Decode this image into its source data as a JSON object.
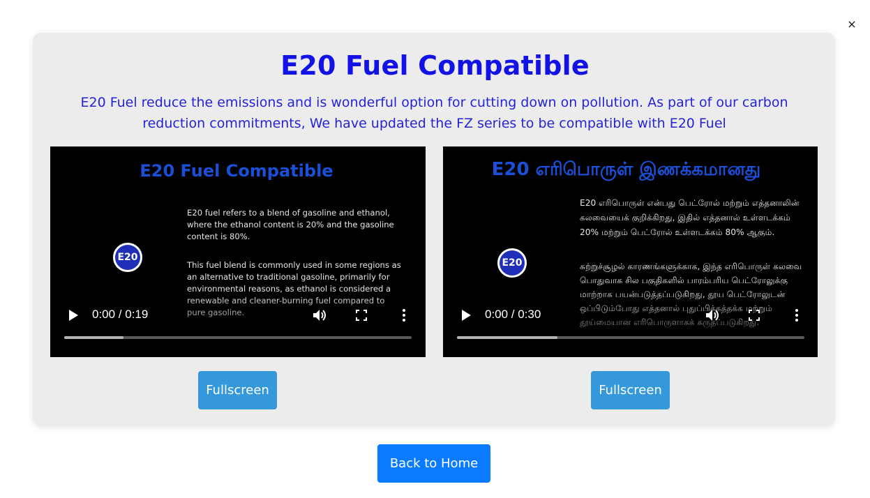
{
  "close_label": "×",
  "header": {
    "title": "E20 Fuel Compatible",
    "description": "E20 Fuel reduce the emissions and is wonderful option for cutting down on pollution. As part of our carbon reduction commitments, We have updated the FZ series to be compatible with E20 Fuel"
  },
  "videos": [
    {
      "title": "E20 Fuel Compatible",
      "badge": "E20",
      "paragraph1": "E20 fuel refers to a blend of gasoline and ethanol, where the ethanol content is 20% and the gasoline content is 80%.",
      "paragraph2": "This fuel blend is commonly used in some regions as an alternative to traditional gasoline, primarily for environmental reasons, as ethanol is considered a renewable and cleaner-burning fuel compared to pure gasoline.",
      "time": "0:00 / 0:19",
      "buffered_fraction": 0.17,
      "fullscreen_label": "Fullscreen"
    },
    {
      "title": "E20 எரிபொருள் இணக்கமானது",
      "badge": "E20",
      "paragraph1": "E20 எரிபொருள் என்பது பெட்ரோல் மற்றும் எத்தனாலின் கலவையைக் குறிக்கிறது, இதில் எத்தனால் உள்ளடக்கம் 20% மற்றும் பெட்ரோல் உள்ளடக்கம் 80% ஆகும்.",
      "paragraph2": "சுற்றுச்சூழல் காரணங்களுக்காக, இந்த எரிபொருள் கலவை பொதுவாக சில பகுதிகளில் பாரம்பரிய பெட்ரோலுக்கு மாற்றாக பயன்படுத்தப்படுகிறது, தூய பெட்ரோலுடன் ஒப்பிடும்போது எத்தனால் புதுப்பிக்கத்தக்க மற்றும் தூய்மையான எரிபொருளாகக் கருதப்படுகிறது.",
      "time": "0:00 / 0:30",
      "buffered_fraction": 0.29,
      "fullscreen_label": "Fullscreen"
    }
  ],
  "back_label": "Back to Home",
  "colors": {
    "title": "#1212e6",
    "description": "#2424d6",
    "fullscreen_button": "#3498db",
    "back_button": "#0a7bff"
  }
}
